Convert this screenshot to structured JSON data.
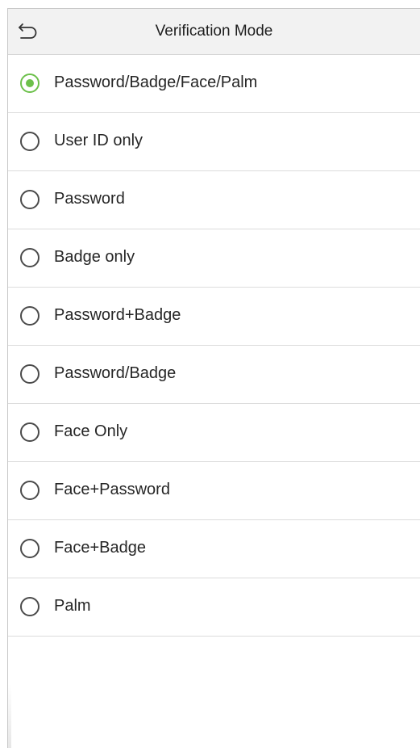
{
  "header": {
    "title": "Verification Mode",
    "back_icon": "back-arrow-icon"
  },
  "accent_color": "#6cc04a",
  "selected_index": 0,
  "options": [
    {
      "label": "Password/Badge/Face/Palm",
      "selected": true
    },
    {
      "label": "User ID only",
      "selected": false
    },
    {
      "label": "Password",
      "selected": false
    },
    {
      "label": "Badge only",
      "selected": false
    },
    {
      "label": "Password+Badge",
      "selected": false
    },
    {
      "label": "Password/Badge",
      "selected": false
    },
    {
      "label": "Face Only",
      "selected": false
    },
    {
      "label": "Face+Password",
      "selected": false
    },
    {
      "label": "Face+Badge",
      "selected": false
    },
    {
      "label": "Palm",
      "selected": false
    }
  ]
}
